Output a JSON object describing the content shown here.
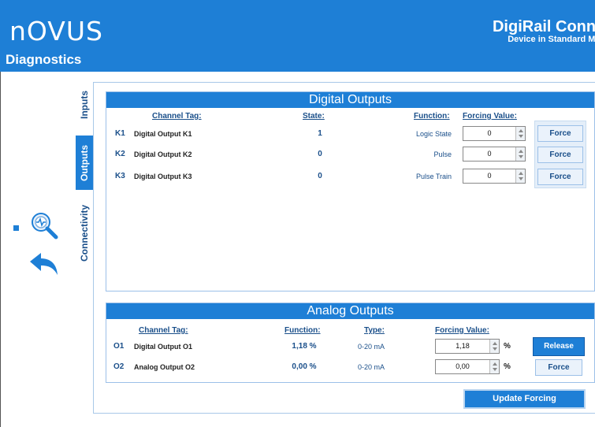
{
  "header": {
    "logo": "nOVUS",
    "page_title": "Diagnostics",
    "app_title": "DigiRail Connect",
    "app_subtitle": "Device in Standard Mode"
  },
  "tabs": [
    {
      "label": "Inputs",
      "active": false
    },
    {
      "label": "Outputs",
      "active": true
    },
    {
      "label": "Connectivity",
      "active": false
    }
  ],
  "digital_outputs": {
    "title": "Digital Outputs",
    "headers": {
      "tag": "Channel Tag:",
      "state": "State:",
      "function": "Function:",
      "forcing": "Forcing Value:"
    },
    "rows": [
      {
        "id": "K1",
        "tag": "Digital Output K1",
        "state": "1",
        "function": "Logic State",
        "forcing": "0",
        "button": "Force"
      },
      {
        "id": "K2",
        "tag": "Digital Output K2",
        "state": "0",
        "function": "Pulse",
        "forcing": "0",
        "button": "Force"
      },
      {
        "id": "K3",
        "tag": "Digital Output K3",
        "state": "0",
        "function": "Pulse Train",
        "forcing": "0",
        "button": "Force"
      }
    ]
  },
  "analog_outputs": {
    "title": "Analog Outputs",
    "headers": {
      "tag": "Channel Tag:",
      "function": "Function:",
      "type": "Type:",
      "forcing": "Forcing Value:"
    },
    "rows": [
      {
        "id": "O1",
        "tag": "Digital Output O1",
        "function": "1,18 %",
        "type": "0-20 mA",
        "forcing": "1,18",
        "unit": "%",
        "button": "Release"
      },
      {
        "id": "O2",
        "tag": "Analog Output O2",
        "function": "0,00 %",
        "type": "0-20 mA",
        "forcing": "0,00",
        "unit": "%",
        "button": "Force"
      }
    ]
  },
  "update_button": "Update Forcing",
  "icons": {
    "diagnostics": "magnifier-pulse-icon",
    "back": "back-arrow-icon"
  },
  "colors": {
    "accent": "#1e7fd6",
    "text_blue": "#1a4f8a"
  }
}
